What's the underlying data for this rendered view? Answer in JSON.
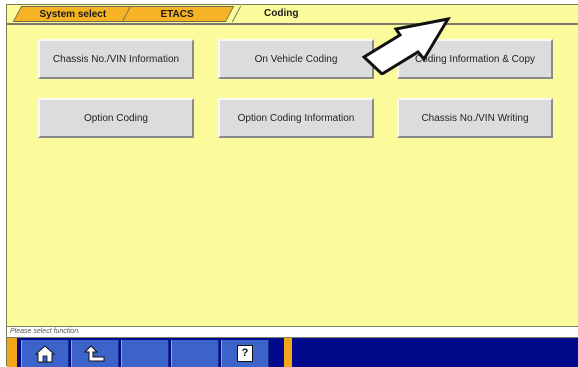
{
  "tabs": [
    {
      "label": "System select"
    },
    {
      "label": "ETACS"
    },
    {
      "label": "Coding"
    }
  ],
  "buttons": {
    "chassis_vin_info": "Chassis No./VIN Information",
    "on_vehicle_coding": "On Vehicle Coding",
    "coding_info_copy": "Coding Information & Copy",
    "option_coding": "Option Coding",
    "option_coding_info": "Option Coding Information",
    "chassis_vin_writing": "Chassis No./VIN Writing"
  },
  "status_text": "Please select function.",
  "toolbar": {
    "help_label": "?",
    "icons": [
      "home-icon",
      "back-icon",
      "empty-slot",
      "empty-slot",
      "help-icon"
    ]
  },
  "colors": {
    "background": "#fbfb9c",
    "active_tab": "#f6b323",
    "toolbar": "#000a8a",
    "toolbar_button": "#3b63c9"
  }
}
